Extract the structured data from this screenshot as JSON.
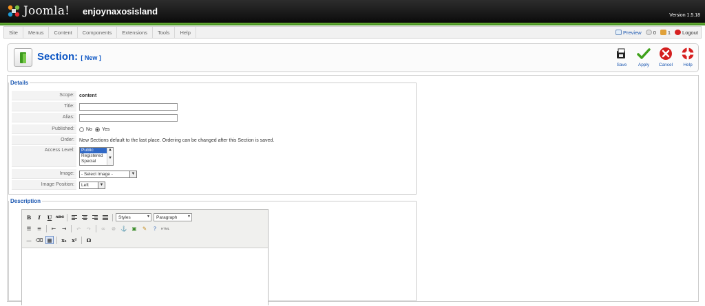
{
  "header": {
    "logo_text": "Joomla!",
    "site_name": "enjoynaxosisland",
    "version": "Version 1.5.18"
  },
  "menu": {
    "items": [
      "Site",
      "Menus",
      "Content",
      "Components",
      "Extensions",
      "Tools",
      "Help"
    ],
    "preview": "Preview",
    "messages_count": "0",
    "users_count": "1",
    "logout": "Logout"
  },
  "toolbar": {
    "title": "Section:",
    "subtitle": "[ New ]",
    "save": "Save",
    "apply": "Apply",
    "cancel": "Cancel",
    "help": "Help"
  },
  "details": {
    "legend": "Details",
    "scope_label": "Scope:",
    "scope_value": "content",
    "title_label": "Title:",
    "title_value": "",
    "alias_label": "Alias:",
    "alias_value": "",
    "published_label": "Published:",
    "published_no": "No",
    "published_yes": "Yes",
    "published_selected": "Yes",
    "order_label": "Order:",
    "order_value": "New Sections default to the last place. Ordering can be changed after this Section is saved.",
    "access_label": "Access Level:",
    "access_options": [
      "Public",
      "Registered",
      "Special"
    ],
    "access_selected": "Public",
    "image_label": "Image:",
    "image_value": "- Select Image -",
    "image_position_label": "Image Position:",
    "image_position_value": "Left"
  },
  "description": {
    "legend": "Description",
    "styles_dropdown": "Styles",
    "format_dropdown": "Paragraph",
    "html_button": "HTML"
  },
  "colors": {
    "accent_blue": "#1b57b1",
    "title_blue": "#0b55c4",
    "header_green": "#4f9e2a"
  }
}
